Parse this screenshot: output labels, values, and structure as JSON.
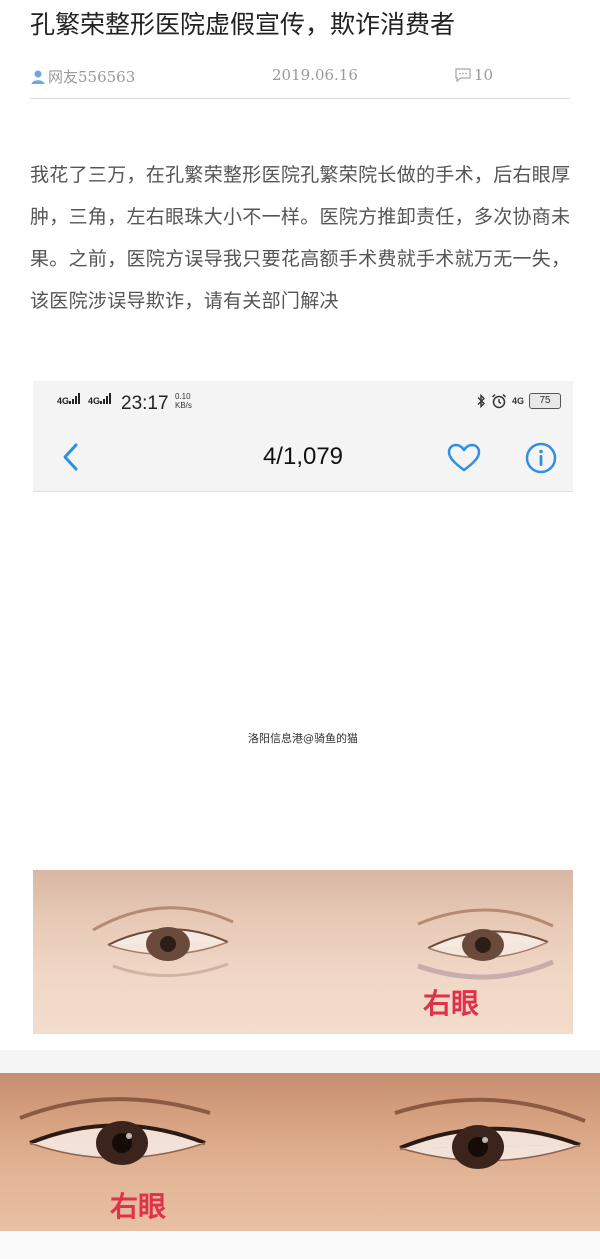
{
  "article": {
    "title": "孔繁荣整形医院虚假宣传，欺诈消费者",
    "author": "网友556563",
    "date": "2019.06.16",
    "comment_count": "10",
    "body": "我花了三万，在孔繁荣整形医院孔繁荣院长做的手术，后右眼厚肿，三角，左右眼珠大小不一样。医院方推卸责任，多次协商未果。之前，医院方误导我只要花高额手术费就手术就万无一失，该医院涉误导欺诈，请有关部门解决"
  },
  "phone_screenshot": {
    "status_bar": {
      "signal_1": "4G",
      "signal_2": "4G",
      "time": "23:17",
      "speed_value": "0.10",
      "speed_unit": "KB/s",
      "network_right": "4G",
      "battery": "75"
    },
    "nav": {
      "counter": "4/1,079"
    },
    "watermark": "洛阳信息港@骑鱼的猫"
  },
  "photos": {
    "label_top": "右眼",
    "label_bottom": "右眼"
  },
  "colors": {
    "accent_blue": "#2f8fe0",
    "label_red": "#e0304a"
  }
}
